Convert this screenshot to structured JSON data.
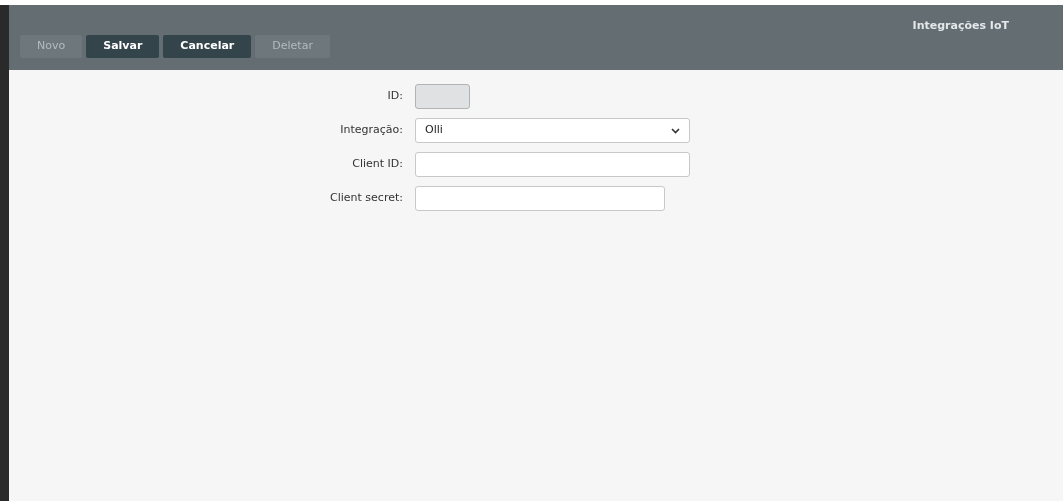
{
  "page_title": "Integrações IoT",
  "toolbar": [
    {
      "label": "Novo",
      "disabled": true
    },
    {
      "label": "Salvar",
      "disabled": false
    },
    {
      "label": "Cancelar",
      "disabled": false
    },
    {
      "label": "Deletar",
      "disabled": true
    }
  ],
  "form": [
    {
      "kind": "text",
      "label": "ID:",
      "disabled": true
    },
    {
      "kind": "select",
      "label": "Integração:",
      "value": "Olli"
    },
    {
      "kind": "text",
      "label": "Client ID:",
      "disabled": false
    },
    {
      "kind": "text",
      "label": "Client secret:",
      "disabled": false
    }
  ]
}
